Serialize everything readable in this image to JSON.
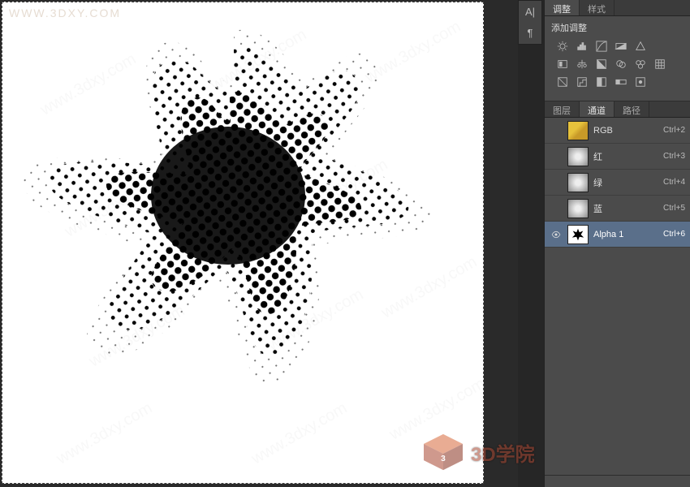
{
  "watermark": {
    "url": "WWW.3DXY.COM",
    "bg_text": "www.3dxy.com"
  },
  "mini_toolbar": {
    "paragraph": "A|",
    "pilcrow": "¶"
  },
  "adjustments_panel": {
    "tabs": [
      {
        "label": "调整",
        "active": true
      },
      {
        "label": "样式",
        "active": false
      }
    ],
    "title": "添加调整"
  },
  "channels_panel": {
    "tabs": [
      {
        "label": "图层",
        "active": false
      },
      {
        "label": "通道",
        "active": true
      },
      {
        "label": "路径",
        "active": false
      }
    ],
    "rows": [
      {
        "name": "RGB",
        "shortcut": "Ctrl+2",
        "thumb": "rgb",
        "eye": false,
        "selected": false
      },
      {
        "name": "红",
        "shortcut": "Ctrl+3",
        "thumb": "gray",
        "eye": false,
        "selected": false
      },
      {
        "name": "绿",
        "shortcut": "Ctrl+4",
        "thumb": "gray",
        "eye": false,
        "selected": false
      },
      {
        "name": "蓝",
        "shortcut": "Ctrl+5",
        "thumb": "gray",
        "eye": false,
        "selected": false
      },
      {
        "name": "Alpha 1",
        "shortcut": "Ctrl+6",
        "thumb": "alpha",
        "eye": true,
        "selected": true
      }
    ]
  },
  "logo": {
    "text": "3D学院"
  }
}
